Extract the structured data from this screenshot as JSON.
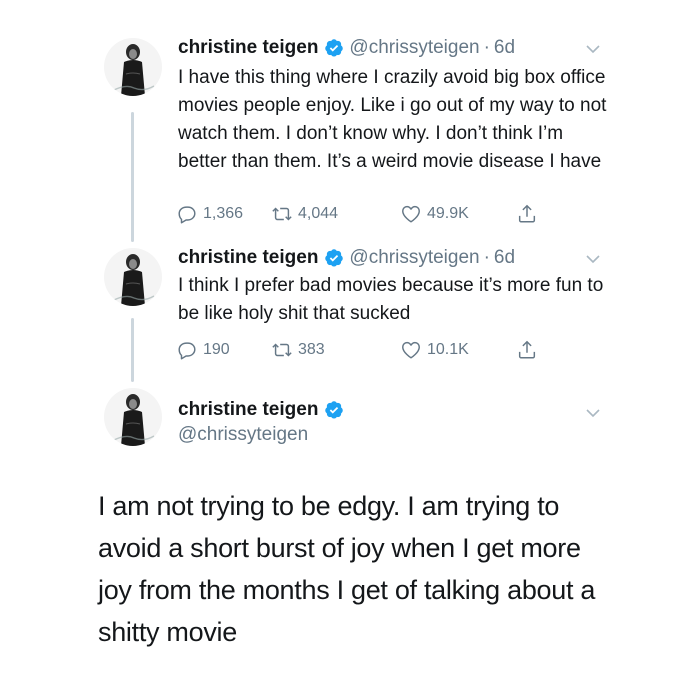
{
  "tweets": [
    {
      "name": "christine teigen",
      "handle": "@chrissyteigen",
      "separator": "·",
      "time": "6d",
      "text": "I have this thing where I crazily avoid big box office movies people enjoy. Like i go out of my way to not watch them. I don’t know why. I don’t think I’m better than them. It’s a weird movie disease I have",
      "replies": "1,366",
      "retweets": "4,044",
      "likes": "49.9K"
    },
    {
      "name": "christine teigen",
      "handle": "@chrissyteigen",
      "separator": "·",
      "time": "6d",
      "text": "I think I prefer bad movies because it’s more fun to be like holy shit that sucked",
      "replies": "190",
      "retweets": "383",
      "likes": "10.1K"
    }
  ],
  "focused_tweet": {
    "name": "christine teigen",
    "handle": "@chrissyteigen",
    "text": "I am not trying to be edgy. I am trying to avoid a short burst of joy when I get more joy from the months I get of talking about a shitty movie"
  },
  "colors": {
    "text": "#14171a",
    "secondary": "#657786",
    "verified": "#1da1f2",
    "thread_line": "#ccd6dd"
  },
  "icons": {
    "reply": "reply-icon",
    "retweet": "retweet-icon",
    "like": "heart-icon",
    "share": "share-icon",
    "menu": "chevron-down-icon",
    "verified": "verified-badge-icon"
  }
}
